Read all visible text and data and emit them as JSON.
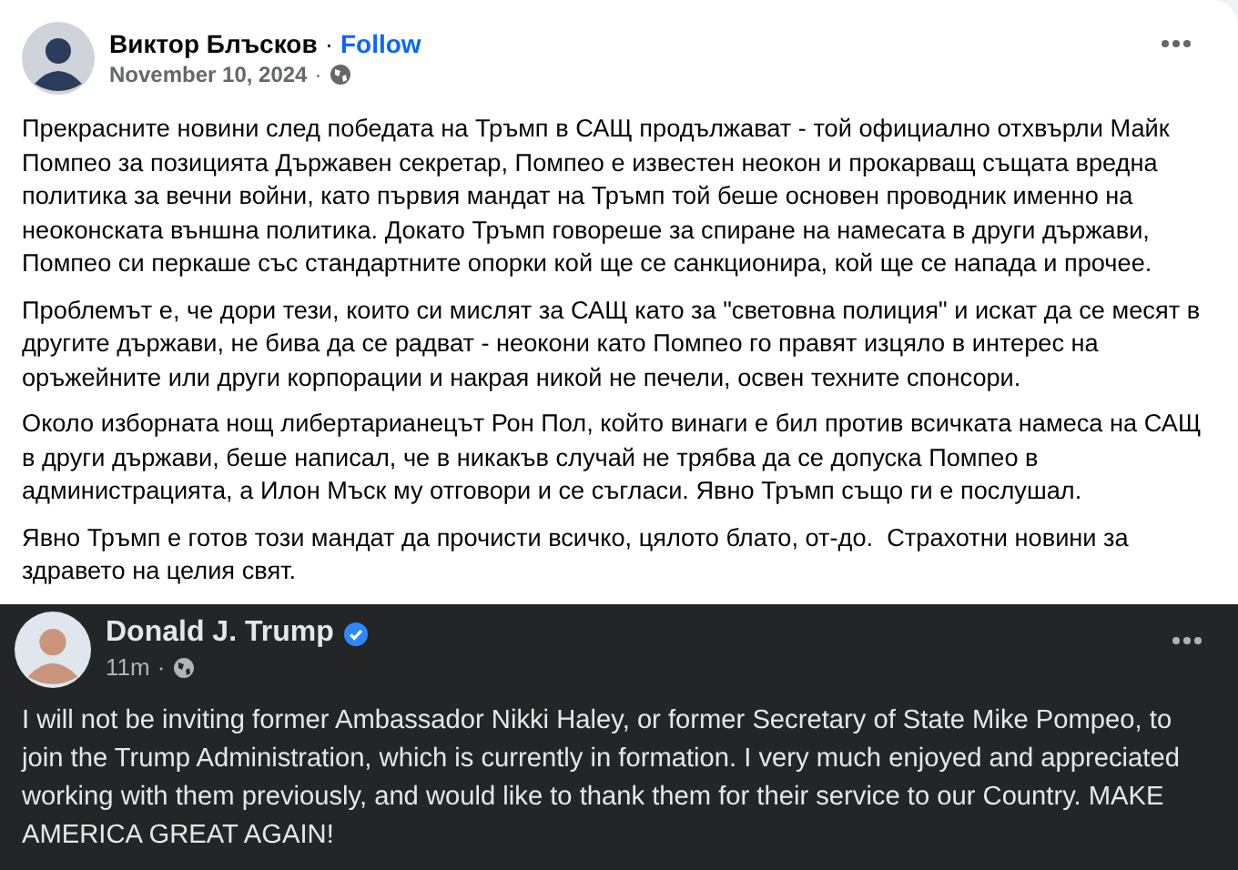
{
  "post": {
    "author": "Виктор Блъсков",
    "separator": "·",
    "follow": "Follow",
    "date": "November 10, 2024",
    "date_separator": "·",
    "paragraphs": [
      "Прекрасните новини след победата на Тръмп в САЩ продължават - той официално отхвърли Майк Помпео за позицията Държавен секретар, Помпео е известен неокон и прокарващ същата вредна политика за вечни войни, като първия мандат на Тръмп той беше основен проводник именно на неоконската външна политика. Докато Тръмп говореше за спиране на намесата в други държави, Помпео си перкаше със стандартните опорки кой ще се санкционира, кой ще се напада и прочее.",
      "Проблемът е, че дори тези, които си мислят за САЩ като за \"световна полиция\" и искат да се месят в другите държави, не бива да се радват - неокони като Помпео го правят изцяло в интерес на оръжейните или други корпорации и накрая никой не печели, освен техните спонсори.",
      "Около изборната нощ либертарианецът Рон Пол, който винаги е бил против всичката намеса на САЩ в други държави, беше написал, че в никакъв случай не трябва да се допуска Помпео в администрацията, а Илон Мъск му отговори и се съгласи. Явно Тръмп също ги е послушал.",
      "Явно Тръмп е готов този мандат да прочисти всичко, цялото блато, от-до.  Страхотни новини за здравето на целия свят."
    ]
  },
  "shared": {
    "author": "Donald J. Trump",
    "verified": true,
    "time": "11m",
    "time_separator": "·",
    "text": "I will not be inviting former Ambassador Nikki Haley, or former Secretary of State Mike Pompeo, to join the Trump Administration, which is currently in formation. I very much enjoyed and appreciated working with them previously, and would like to thank them for their service to our Country. MAKE AMERICA GREAT AGAIN!"
  }
}
